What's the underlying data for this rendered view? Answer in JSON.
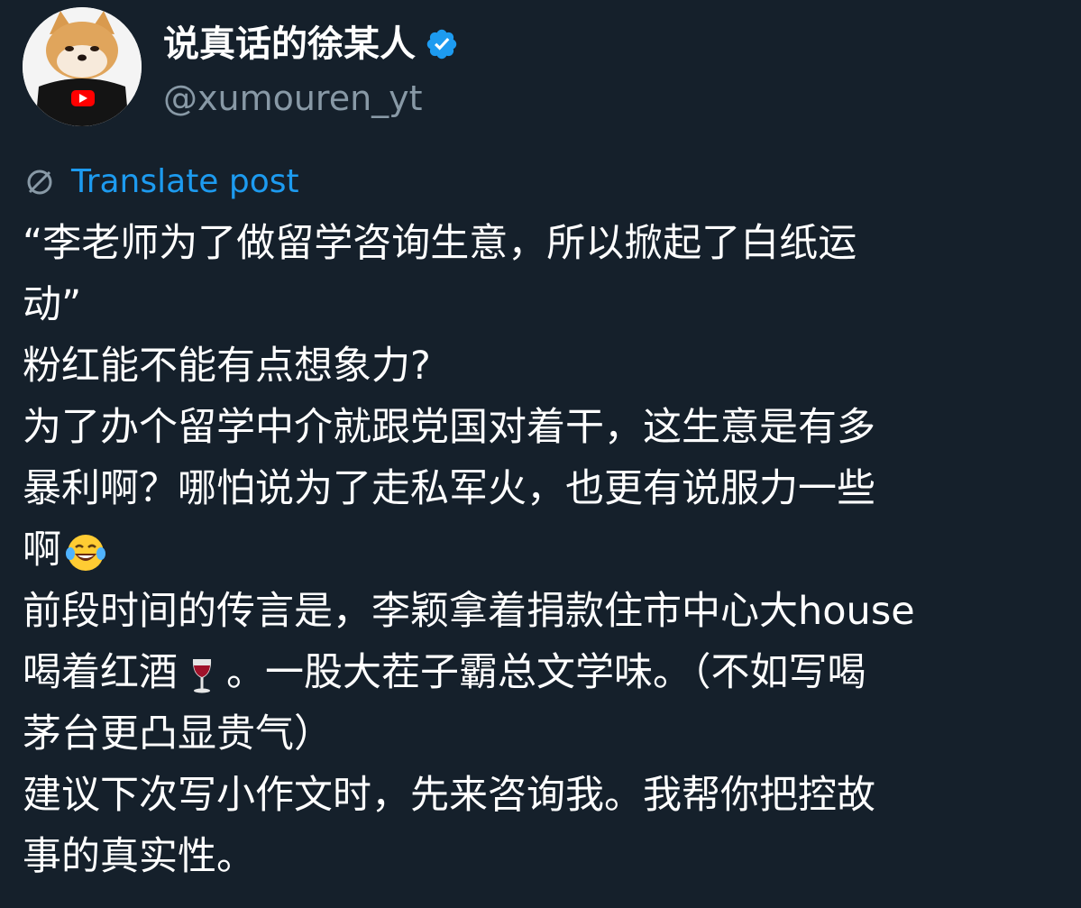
{
  "author": {
    "display_name": "说真话的徐某人",
    "handle": "@xumouren_yt",
    "verified": true,
    "avatar_icon": "shiba-dog-youtube-shirt-avatar",
    "verified_color": "#1d9bf0"
  },
  "translate": {
    "label": "Translate post",
    "icon": "globe-icon",
    "color": "#1d9bf0"
  },
  "post": {
    "lines": [
      "“李老师为了做留学咨询生意，所以掀起了白纸运",
      "动”",
      "粉红能不能有点想象力?",
      "为了办个留学中介就跟党国对着干，这生意是有多",
      "暴利啊？哪怕说为了走私军火，也更有说服力一些",
      "啊",
      "前段时间的传言是，李颖拿着捐款住市中心大house",
      "喝着红酒",
      "。一股大茬子霸总文学味。（不如写喝",
      "茅台更凸显贵气）",
      "建议下次写小作文时，先来咨询我。我帮你把控故",
      "事的真实性。"
    ],
    "emojis": {
      "laughing": "face-with-tears-of-joy-icon",
      "wine": "wine-glass-icon"
    }
  },
  "colors": {
    "background": "#15202b",
    "text": "#ffffff",
    "secondary": "#8899a6",
    "accent": "#1d9bf0"
  }
}
